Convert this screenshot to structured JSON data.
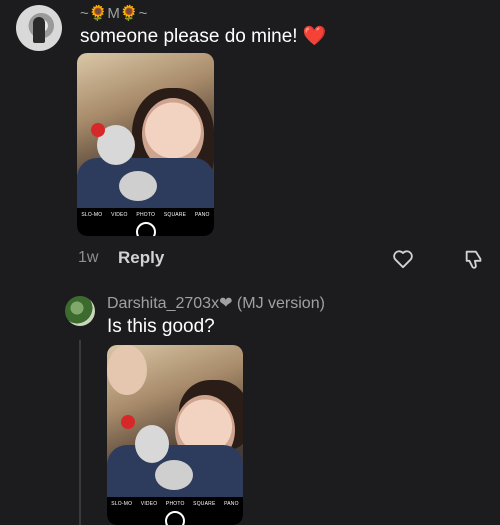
{
  "comment": {
    "username": "~🌻M🌻~",
    "text": "someone please do mine! ❤️",
    "age": "1w",
    "reply_label": "Reply",
    "photo_modes": [
      "SLO-MO",
      "VIDEO",
      "PHOTO",
      "SQUARE",
      "PANO"
    ]
  },
  "reply": {
    "username": "Darshita_2703x❤ (MJ version)",
    "text": "Is this good?",
    "photo_modes": [
      "SLO-MO",
      "VIDEO",
      "PHOTO",
      "SQUARE",
      "PANO"
    ]
  }
}
